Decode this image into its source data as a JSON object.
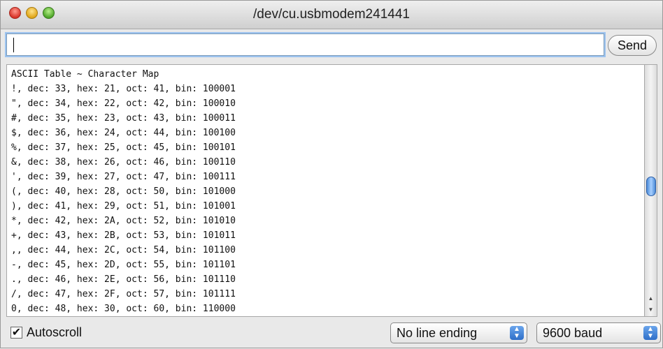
{
  "window": {
    "title": "/dev/cu.usbmodem241441"
  },
  "input": {
    "value": "",
    "send_label": "Send"
  },
  "output": {
    "lines": [
      "ASCII Table ~ Character Map",
      "!, dec: 33, hex: 21, oct: 41, bin: 100001",
      "\", dec: 34, hex: 22, oct: 42, bin: 100010",
      "#, dec: 35, hex: 23, oct: 43, bin: 100011",
      "$, dec: 36, hex: 24, oct: 44, bin: 100100",
      "%, dec: 37, hex: 25, oct: 45, bin: 100101",
      "&, dec: 38, hex: 26, oct: 46, bin: 100110",
      "', dec: 39, hex: 27, oct: 47, bin: 100111",
      "(, dec: 40, hex: 28, oct: 50, bin: 101000",
      "), dec: 41, hex: 29, oct: 51, bin: 101001",
      "*, dec: 42, hex: 2A, oct: 52, bin: 101010",
      "+, dec: 43, hex: 2B, oct: 53, bin: 101011",
      ",, dec: 44, hex: 2C, oct: 54, bin: 101100",
      "-, dec: 45, hex: 2D, oct: 55, bin: 101101",
      "., dec: 46, hex: 2E, oct: 56, bin: 101110",
      "/, dec: 47, hex: 2F, oct: 57, bin: 101111",
      "0, dec: 48, hex: 30, oct: 60, bin: 110000"
    ]
  },
  "status": {
    "autoscroll_label": "Autoscroll",
    "autoscroll_checked": true,
    "line_ending_selected": "No line ending",
    "baud_selected": "9600 baud"
  },
  "icons": {
    "close": "close-icon",
    "minimize": "minimize-icon",
    "maximize": "maximize-icon",
    "checkbox": "checkmark-icon",
    "select_arrows": "select-arrows-icon"
  }
}
